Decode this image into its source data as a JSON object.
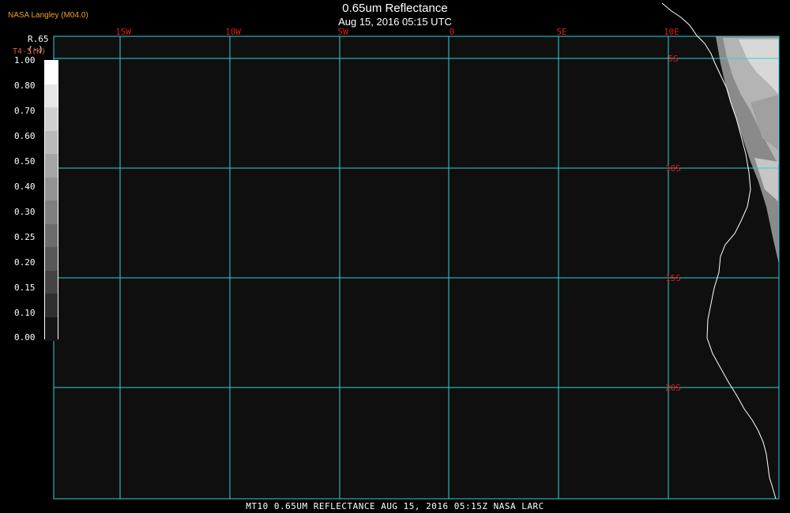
{
  "header": {
    "source": "NASA Langley (M04.0)",
    "title": "0.65um Reflectance",
    "subtitle": "Aug 15, 2016 05:15 UTC"
  },
  "footer": {
    "caption": "MT10  0.65UM REFLECTANCE   AUG 15, 2016 05:15Z   NASA LARC"
  },
  "colorbar": {
    "label_primary": "R.65",
    "label_primary_unit": "(-)",
    "label_secondary": "T4-5(K)",
    "ticks": [
      "1.00",
      "0.80",
      "0.70",
      "0.60",
      "0.50",
      "0.40",
      "0.30",
      "0.25",
      "0.20",
      "0.15",
      "0.10",
      "0.00"
    ],
    "gray_levels": [
      "#ffffff",
      "#e6e6e6",
      "#cfcfcf",
      "#bababa",
      "#a5a5a5",
      "#939393",
      "#7f7f7f",
      "#6c6c6c",
      "#585858",
      "#444444",
      "#2f2f2f",
      "#151515"
    ]
  },
  "map": {
    "longitude_labels": [
      "15W",
      "10W",
      "5W",
      "0",
      "5E",
      "10E"
    ],
    "latitude_labels": [
      "5S",
      "10S",
      "15S",
      "20S"
    ],
    "colors": {
      "background": "#0f0f0f",
      "grid": "#2fd3d3",
      "grid_label": "#e01818",
      "coastline": "#ffffff"
    }
  }
}
